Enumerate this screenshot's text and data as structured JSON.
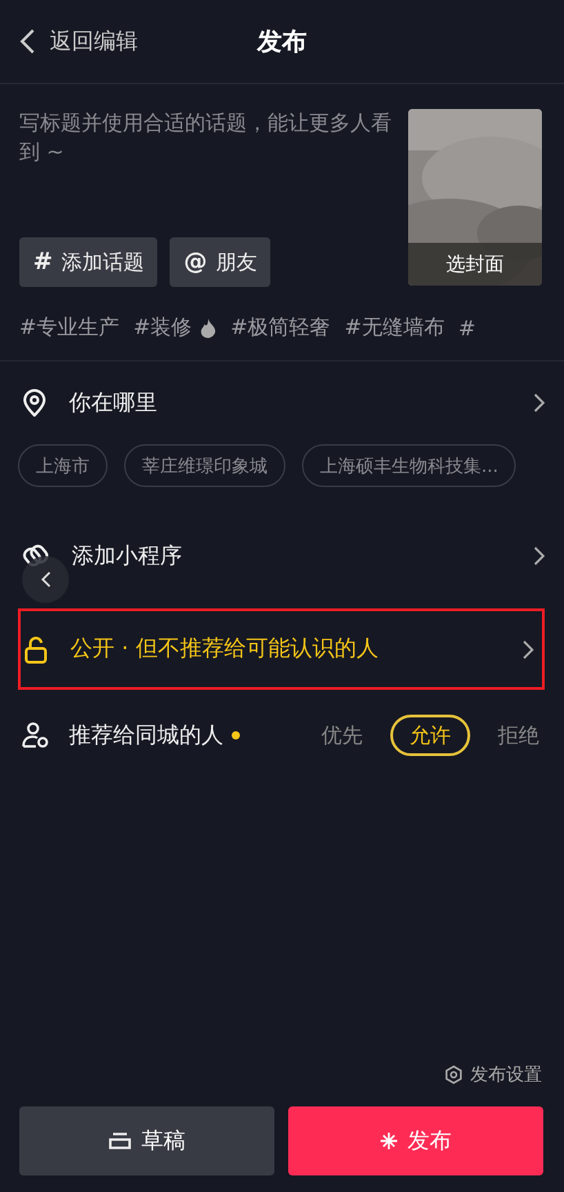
{
  "header": {
    "back_label": "返回编辑",
    "title": "发布"
  },
  "caption": {
    "placeholder": "写标题并使用合适的话题，能让更多人看到 ~"
  },
  "cover": {
    "label": "选封面"
  },
  "quick_buttons": [
    {
      "glyph": "#",
      "label": "添加话题"
    },
    {
      "glyph": "@",
      "label": "朋友"
    }
  ],
  "topics": [
    {
      "label": "#专业生产",
      "hot": false
    },
    {
      "label": "#装修",
      "hot": true
    },
    {
      "label": "#极简轻奢",
      "hot": false
    },
    {
      "label": "#无缝墙布",
      "hot": false
    },
    {
      "label": "#",
      "hot": false
    }
  ],
  "location": {
    "label": "你在哪里",
    "chips": [
      "上海市",
      "莘庄维璟印象城",
      "上海硕丰生物科技集..."
    ]
  },
  "mini_program": {
    "label": "添加小程序"
  },
  "privacy": {
    "label": "公开 · 但不推荐给可能认识的人",
    "highlighted": true
  },
  "same_city": {
    "label": "推荐给同城的人",
    "options": [
      {
        "label": "优先",
        "selected": false
      },
      {
        "label": "允许",
        "selected": true
      },
      {
        "label": "拒绝",
        "selected": false
      }
    ]
  },
  "settings": {
    "label": "发布设置"
  },
  "actions": [
    {
      "kind": "draft",
      "label": "草稿"
    },
    {
      "kind": "publish",
      "label": "发布"
    }
  ]
}
